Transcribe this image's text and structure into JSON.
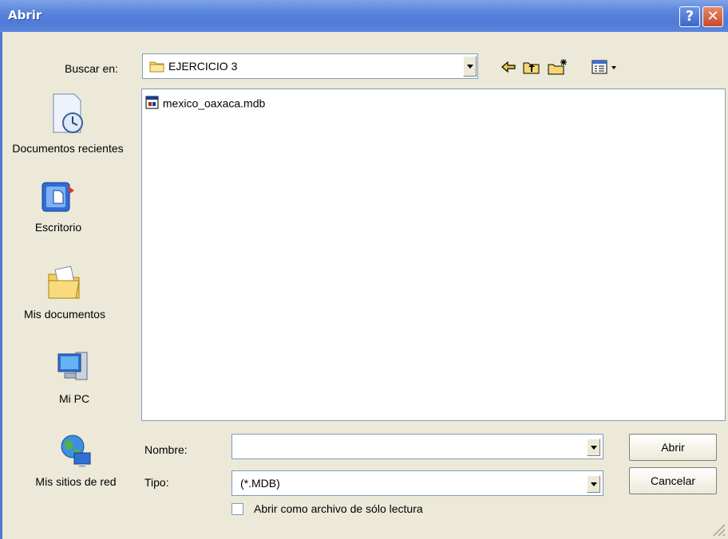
{
  "window": {
    "title": "Abrir",
    "help_label": "?",
    "close_label": "✕"
  },
  "lookin": {
    "label": "Buscar en:",
    "value": "EJERCICIO 3"
  },
  "toolbar": {
    "icons": [
      "back-icon",
      "up-folder-icon",
      "new-folder-icon",
      "view-menu-icon"
    ]
  },
  "places": [
    {
      "label": "Documentos recientes",
      "icon": "recent-documents-icon"
    },
    {
      "label": "Escritorio",
      "icon": "desktop-icon"
    },
    {
      "label": "Mis documentos",
      "icon": "my-documents-icon"
    },
    {
      "label": "Mi PC",
      "icon": "my-computer-icon"
    },
    {
      "label": "Mis sitios de red",
      "icon": "network-places-icon"
    }
  ],
  "files": [
    {
      "name": "mexico_oaxaca.mdb",
      "icon": "access-database-icon"
    }
  ],
  "filename": {
    "label": "Nombre:",
    "value": ""
  },
  "filetype": {
    "label": "Tipo:",
    "value": "(*.MDB)"
  },
  "readonly": {
    "label": "Abrir como archivo de sólo lectura",
    "checked": false
  },
  "buttons": {
    "open": "Abrir",
    "cancel": "Cancelar"
  },
  "colors": {
    "titlebar": "#5a86dc",
    "dialog_bg": "#ece9d8",
    "close": "#c74a2b"
  }
}
